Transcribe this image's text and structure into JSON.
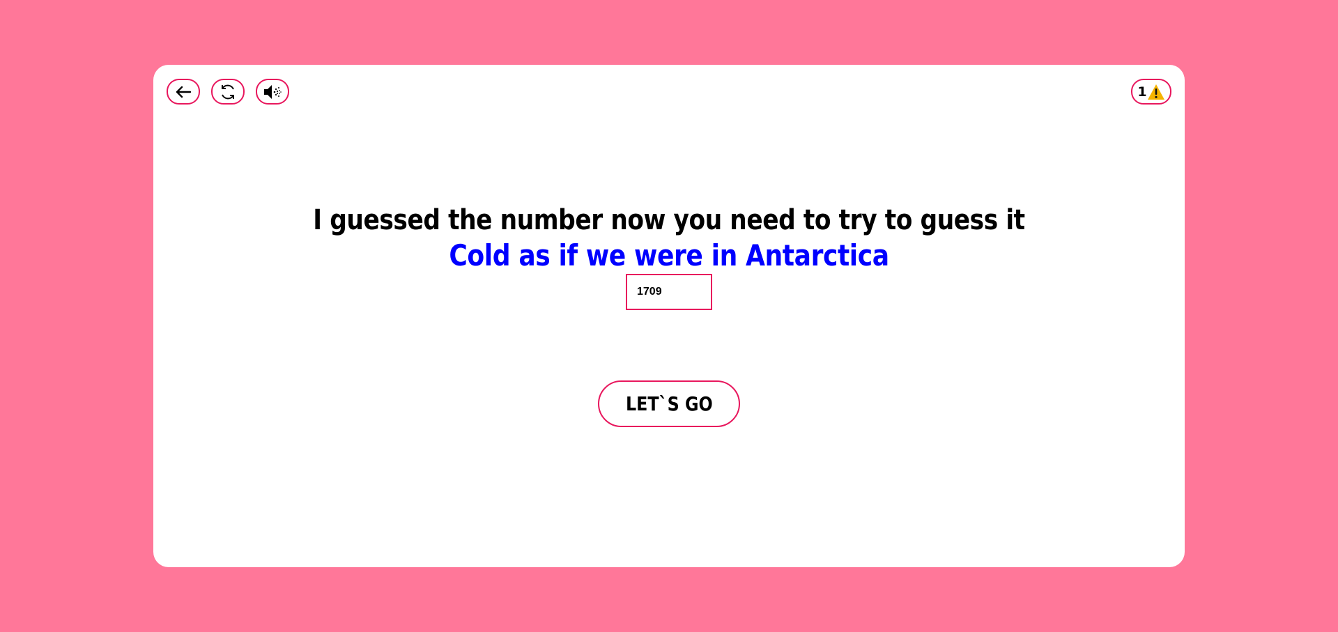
{
  "toolbar": {
    "back_icon": "arrow-left-icon",
    "restart_icon": "refresh-icon",
    "sound_icon": "speaker-icon",
    "hint_icon": "warning-icon",
    "hint_count": "1"
  },
  "game": {
    "title": "I guessed the number now you need to try to guess it",
    "feedback": "Cold as if we were in Antarctica",
    "guess_value": "1709",
    "submit_label": "LET`S GO"
  },
  "colors": {
    "background": "#ff7799",
    "card": "#ffffff",
    "accent_border": "#e8175d",
    "feedback_text": "#0000ff",
    "warning": "#f5b400"
  }
}
